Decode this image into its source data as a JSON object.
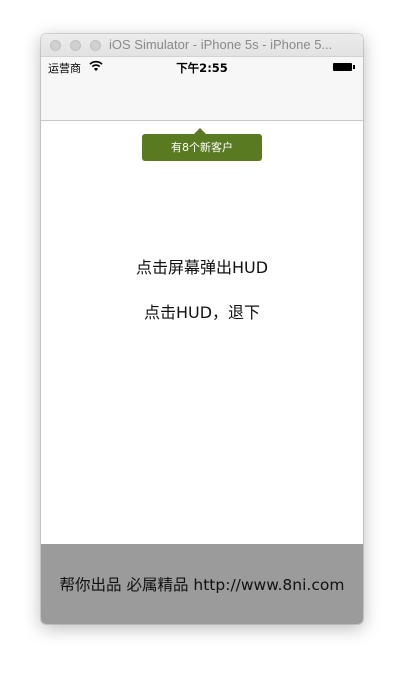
{
  "window": {
    "title": "iOS Simulator - iPhone 5s - iPhone 5..."
  },
  "status_bar": {
    "carrier": "运营商",
    "time": "下午2:55",
    "wifi_icon": "wifi-icon",
    "battery_icon": "battery-icon"
  },
  "hud": {
    "text": "有8个新客户",
    "color": "#5a7a22"
  },
  "content": {
    "line1": "点击屏幕弹出HUD",
    "line2": "点击HUD，退下"
  },
  "footer": {
    "text": "帮你出品 必属精品  http://www.8ni.com",
    "background": "#9b9b9b"
  }
}
